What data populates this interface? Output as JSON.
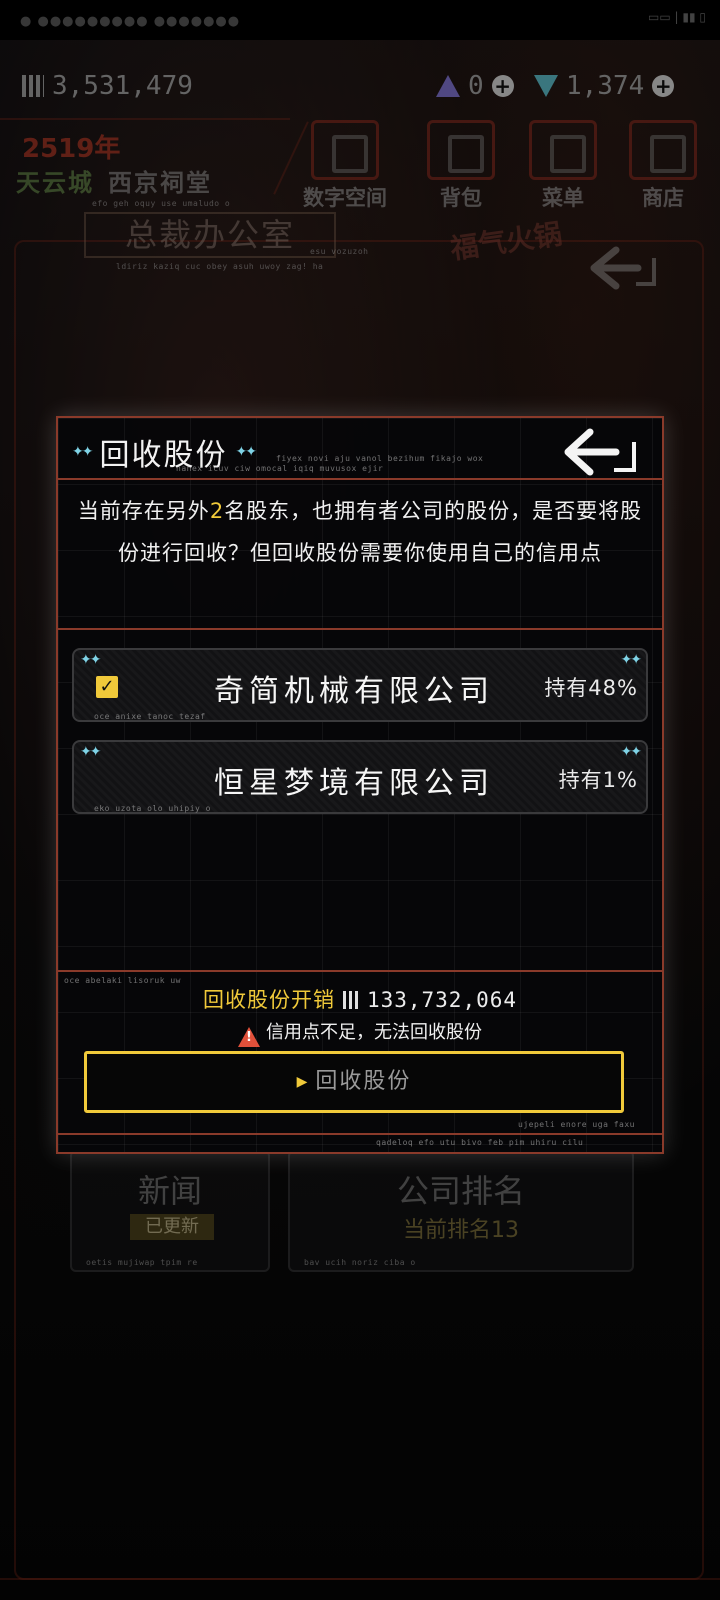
{
  "hud": {
    "credits": "3,531,479",
    "shares": "0",
    "gems": "1,374"
  },
  "location": {
    "year": "2519年",
    "city": "天云城",
    "district": "西京祠堂",
    "room": "总裁办公室",
    "room_sub": "efo geh oquy use umaludo o",
    "room_sub2": "ldiriz kaziq cuc obey asuh uwoy zag! ha",
    "room_sub3": "esu vozuzoh"
  },
  "nav": [
    {
      "label": "数字空间"
    },
    {
      "label": "背包"
    },
    {
      "label": "菜单"
    },
    {
      "label": "商店"
    }
  ],
  "background_panels": {
    "news_label": "新闻",
    "news_badge": "已更新",
    "news_code": "oetis mujiwap tpim re",
    "rank_label": "公司排名",
    "rank_value": "当前排名13",
    "rank_code": "bav ucih noriz ciba o"
  },
  "modal": {
    "title": "回收股份",
    "title_code": "fiyex novi aju vanol bezihum fikajo wox",
    "title_code2": "nanex icuv ciw omocal iqiq muvusox ejir",
    "message_pre": "当前存在另外",
    "message_count": "2",
    "message_post": "名股东，也拥有者公司的股份，是否要将股份进行回收？但回收股份需要你使用自己的信用点",
    "companies": [
      {
        "name": "奇简机械有限公司",
        "holding": "持有48%",
        "code": "oce anixe tanoc tezaf",
        "checked": true
      },
      {
        "name": "恒星梦境有限公司",
        "holding": "持有1%",
        "code": "eko uzota olo uhipiy o",
        "checked": false
      }
    ],
    "footer_code": "oce abelaki lisoruk uw",
    "cost_label": "回收股份开销",
    "cost_amount": "133,732,064",
    "warning": "信用点不足，无法回收股份",
    "button_label": "回收股份",
    "button_code": "ujepeli enore uga faxu",
    "bottom_code": "qadeloq efo utu bivo feb pim uhiru cilu"
  },
  "colors": {
    "accent_gold": "#f0c93a",
    "frame_red": "#8a3a2a",
    "sparkle_cyan": "#7fd3e6",
    "warning_red": "#e0503a"
  }
}
